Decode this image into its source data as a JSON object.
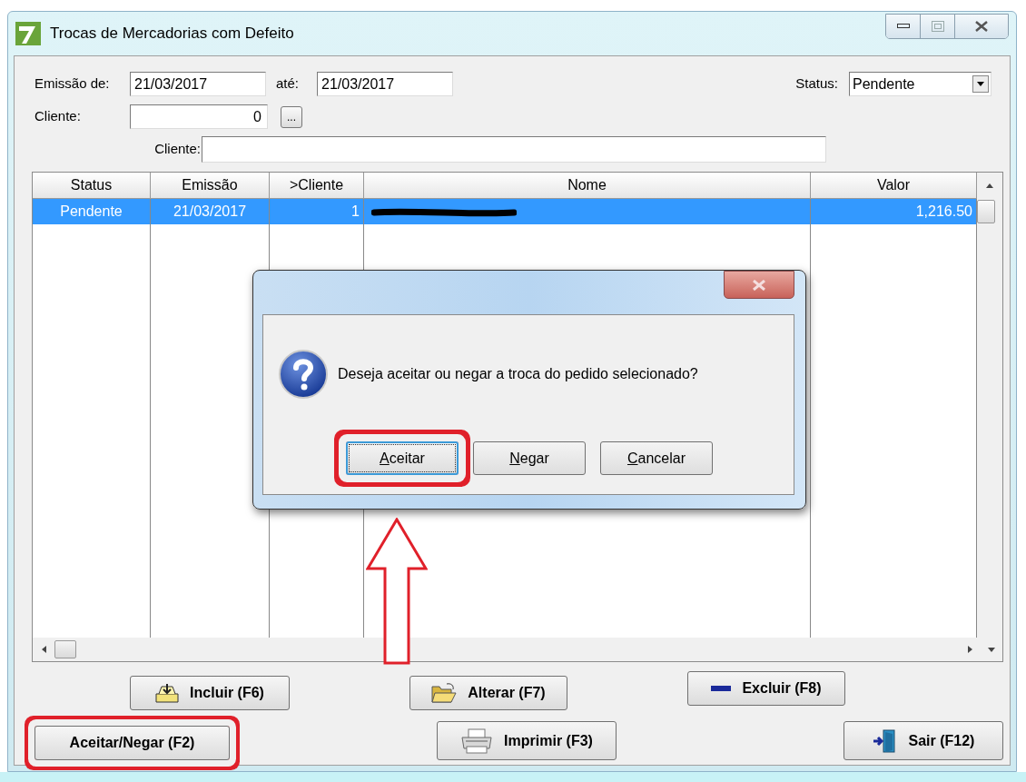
{
  "window": {
    "title": "Trocas de Mercadorias com Defeito"
  },
  "filters": {
    "emissao_label": "Emissão de:",
    "emissao_from": "21/03/2017",
    "ate_label": "até:",
    "emissao_to": "21/03/2017",
    "status_label": "Status:",
    "status_value": "Pendente",
    "cliente_label": "Cliente:",
    "cliente_code": "0",
    "browse_button": "...",
    "cliente_name_label": "Cliente:"
  },
  "table": {
    "columns": [
      "Status",
      "Emissão",
      ">Cliente",
      "Nome",
      "Valor"
    ],
    "rows": [
      {
        "status": "Pendente",
        "emissao": "21/03/2017",
        "cliente": "1",
        "nome_redacted": true,
        "valor": "1,216.50",
        "selected": true
      }
    ]
  },
  "buttons": [
    {
      "label": "Incluir (F6)",
      "highlighted": false
    },
    {
      "label": "Alterar (F7)",
      "highlighted": false
    },
    {
      "label": "Excluir (F8)",
      "highlighted": false
    },
    {
      "label": "Aceitar/Negar (F2)",
      "highlighted": true
    },
    {
      "label": "Imprimir (F3)",
      "highlighted": false
    },
    {
      "label": "Sair (F12)",
      "highlighted": false
    }
  ],
  "dialog": {
    "message": "Deseja aceitar ou negar a troca do pedido selecionado?",
    "buttons": [
      {
        "label": "Aceitar",
        "focused": true,
        "highlighted": true
      },
      {
        "label": "Negar",
        "focused": false,
        "highlighted": false
      },
      {
        "label": "Cancelar",
        "focused": false,
        "highlighted": false
      }
    ]
  }
}
